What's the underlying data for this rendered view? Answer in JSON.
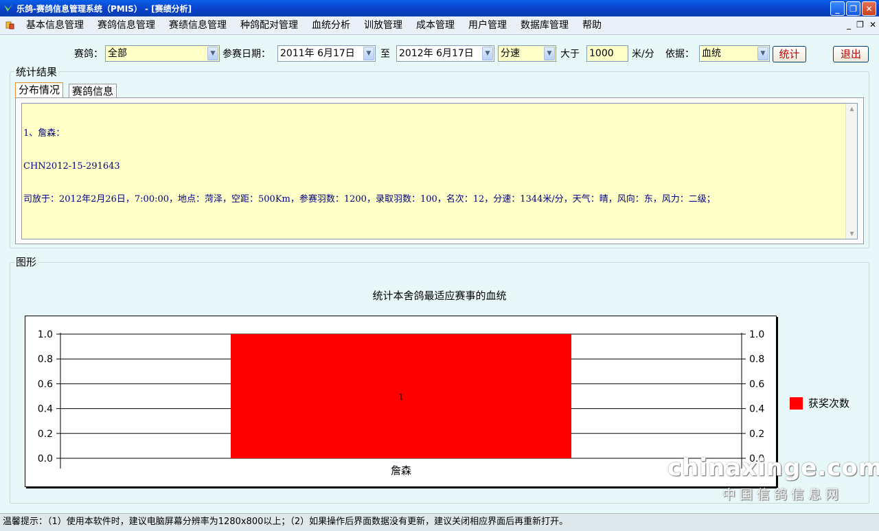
{
  "window": {
    "title": "乐鸽-赛鸽信息管理系统（PMIS） - [赛绩分析]",
    "controls": [
      "_",
      "❐",
      "✕"
    ]
  },
  "menu": {
    "items": [
      "基本信息管理",
      "赛鸽信息管理",
      "赛绩信息管理",
      "种鸽配对管理",
      "血统分析",
      "训放管理",
      "成本管理",
      "用户管理",
      "数据库管理",
      "帮助"
    ],
    "mdi_controls": [
      "_",
      "❐",
      "✕"
    ]
  },
  "filters": {
    "pigeon_label": "赛鸽：",
    "pigeon_value": "全部",
    "date_label": "参赛日期：",
    "date_from": "2011年 6月17日",
    "to_label": "至",
    "date_to": "2012年 6月17日",
    "metric_value": "分速",
    "greater_label": "大于",
    "threshold_value": "1000",
    "unit_label": "米/分",
    "basis_label": "依据：",
    "basis_value": "血统",
    "stat_button": "统计",
    "exit_button": "退出"
  },
  "results": {
    "group_title": "统计结果",
    "tabs": [
      "分布情况",
      "赛鸽信息"
    ],
    "text_lines": [
      "1、詹森：",
      "CHN2012-15-291643",
      "司放于：2012年2月26日，7:00:00，地点：菏泽，空距：500Km，参赛羽数：1200，录取羽数：100，名次：12，分速：1344米/分，天气：晴，风向：东，风力：二级；"
    ]
  },
  "graph": {
    "group_title": "图形"
  },
  "chart_data": {
    "type": "bar",
    "title": "统计本舍鸽最适应赛事的血统",
    "categories": [
      "詹森"
    ],
    "series": [
      {
        "name": "获奖次数",
        "values": [
          1
        ],
        "color": "#ff0000"
      }
    ],
    "data_labels": [
      "1"
    ],
    "ylim": [
      0,
      1.0
    ],
    "yticks": [
      "0.0",
      "0.2",
      "0.4",
      "0.6",
      "0.8",
      "1.0"
    ],
    "grid": true,
    "legend_position": "right",
    "xlabel": "",
    "ylabel": ""
  },
  "watermark": {
    "line1": "chinaxinge.com",
    "line2": "中国信鸽信息网"
  },
  "status": {
    "text": "温馨提示：（1）使用本软件时，建议电脑屏幕分辨率为1280x800以上；（2）如果操作后界面数据没有更新，建议关闭相应界面后再重新打开。"
  }
}
